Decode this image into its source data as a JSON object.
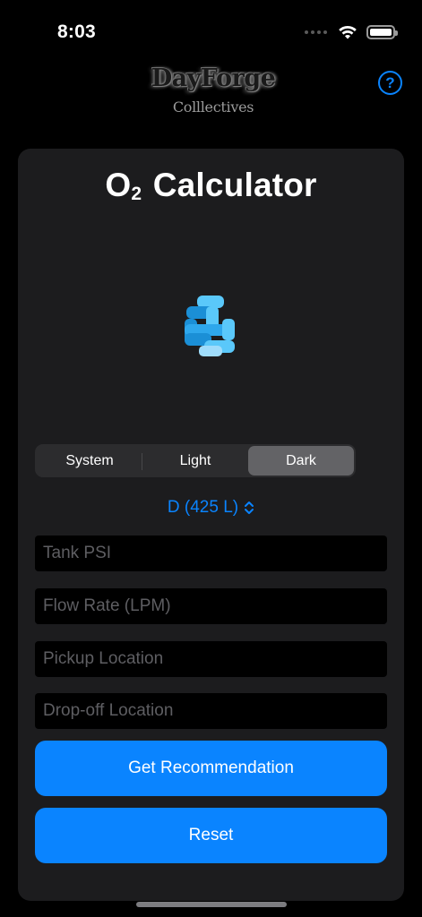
{
  "status_bar": {
    "time": "8:03"
  },
  "brand": {
    "line1": "DayForge",
    "line2": "Colllectives"
  },
  "help": {
    "label": "?"
  },
  "title": {
    "o2_letter": "O",
    "o2_subscript": "2",
    "rest": "Calculator"
  },
  "appearance": {
    "options": [
      "System",
      "Light",
      "Dark"
    ],
    "selected": "Dark"
  },
  "tank": {
    "selected": "D (425 L)"
  },
  "fields": {
    "tank_psi": {
      "placeholder": "Tank PSI",
      "value": ""
    },
    "flow_rate": {
      "placeholder": "Flow Rate (LPM)",
      "value": ""
    },
    "pickup": {
      "placeholder": "Pickup Location",
      "value": ""
    },
    "dropoff": {
      "placeholder": "Drop-off Location",
      "value": ""
    }
  },
  "buttons": {
    "recommend": "Get Recommendation",
    "reset": "Reset"
  },
  "colors": {
    "accent": "#0a84ff",
    "card": "#1c1c1e",
    "background": "#000000",
    "icon_light": "#5ac8fa",
    "icon_dark": "#1b8fd6"
  },
  "icons": [
    "wifi-icon",
    "battery-icon",
    "help-icon",
    "oxygen-logo-icon",
    "chevron-updown-icon"
  ]
}
